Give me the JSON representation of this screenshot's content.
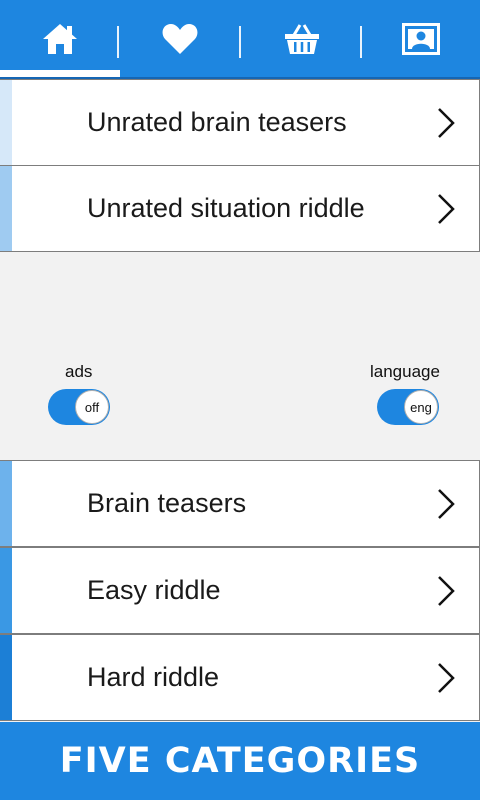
{
  "nav": {
    "tabs": [
      {
        "icon": "home-icon",
        "active": true
      },
      {
        "icon": "heart-icon",
        "active": false
      },
      {
        "icon": "basket-icon",
        "active": false
      },
      {
        "icon": "profile-icon",
        "active": false
      }
    ]
  },
  "top_list": [
    {
      "label": "Unrated brain teasers",
      "stripe": "#d6e8f9"
    },
    {
      "label": "Unrated situation riddle",
      "stripe": "#9fcbf1"
    }
  ],
  "toggles": {
    "ads": {
      "label": "ads",
      "value": "off"
    },
    "language": {
      "label": "language",
      "value": "eng"
    }
  },
  "bottom_list": [
    {
      "label": "Brain teasers",
      "stripe": "#6db2ec"
    },
    {
      "label": "Easy riddle",
      "stripe": "#3a98e4"
    },
    {
      "label": "Hard riddle",
      "stripe": "#1c7fd6"
    }
  ],
  "footer": {
    "text": "FIVE CATEGORIES"
  },
  "colors": {
    "accent": "#1e86e0",
    "background": "#f2f2f2"
  }
}
